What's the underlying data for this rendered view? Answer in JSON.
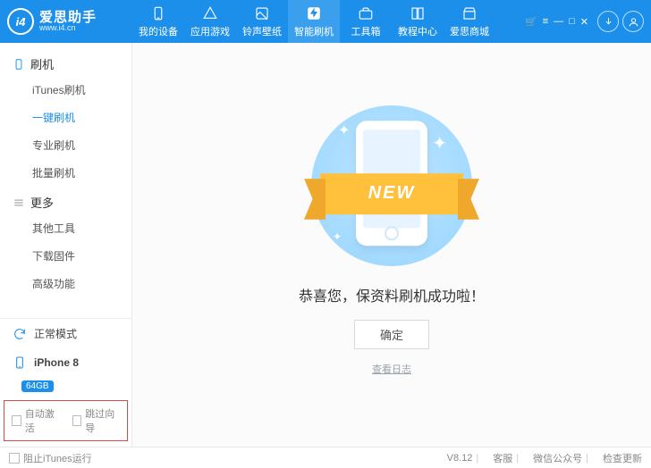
{
  "brand": {
    "mark": "i4",
    "name": "爱思助手",
    "url": "www.i4.cn"
  },
  "winctrls": {
    "cart": "🛒",
    "menu": "≡",
    "min": "—",
    "max": "□",
    "close": "✕"
  },
  "top_tabs": [
    {
      "label": "我的设备"
    },
    {
      "label": "应用游戏"
    },
    {
      "label": "铃声壁纸"
    },
    {
      "label": "智能刷机"
    },
    {
      "label": "工具箱"
    },
    {
      "label": "教程中心"
    },
    {
      "label": "爱思商城"
    }
  ],
  "sidebar": {
    "group_flash": "刷机",
    "group_more": "更多",
    "items_flash": [
      "iTunes刷机",
      "一键刷机",
      "专业刷机",
      "批量刷机"
    ],
    "items_more": [
      "其他工具",
      "下载固件",
      "高级功能"
    ],
    "mode": "正常模式",
    "device": "iPhone 8",
    "storage": "64GB",
    "opt_auto_activate": "自动激活",
    "opt_skip_wizard": "跳过向导"
  },
  "main": {
    "ribbon": "NEW",
    "success": "恭喜您，保资料刷机成功啦！",
    "ok": "确定",
    "log": "查看日志"
  },
  "status": {
    "block_itunes": "阻止iTunes运行",
    "version": "V8.12",
    "support": "客服",
    "wechat": "微信公众号",
    "update": "检查更新"
  }
}
